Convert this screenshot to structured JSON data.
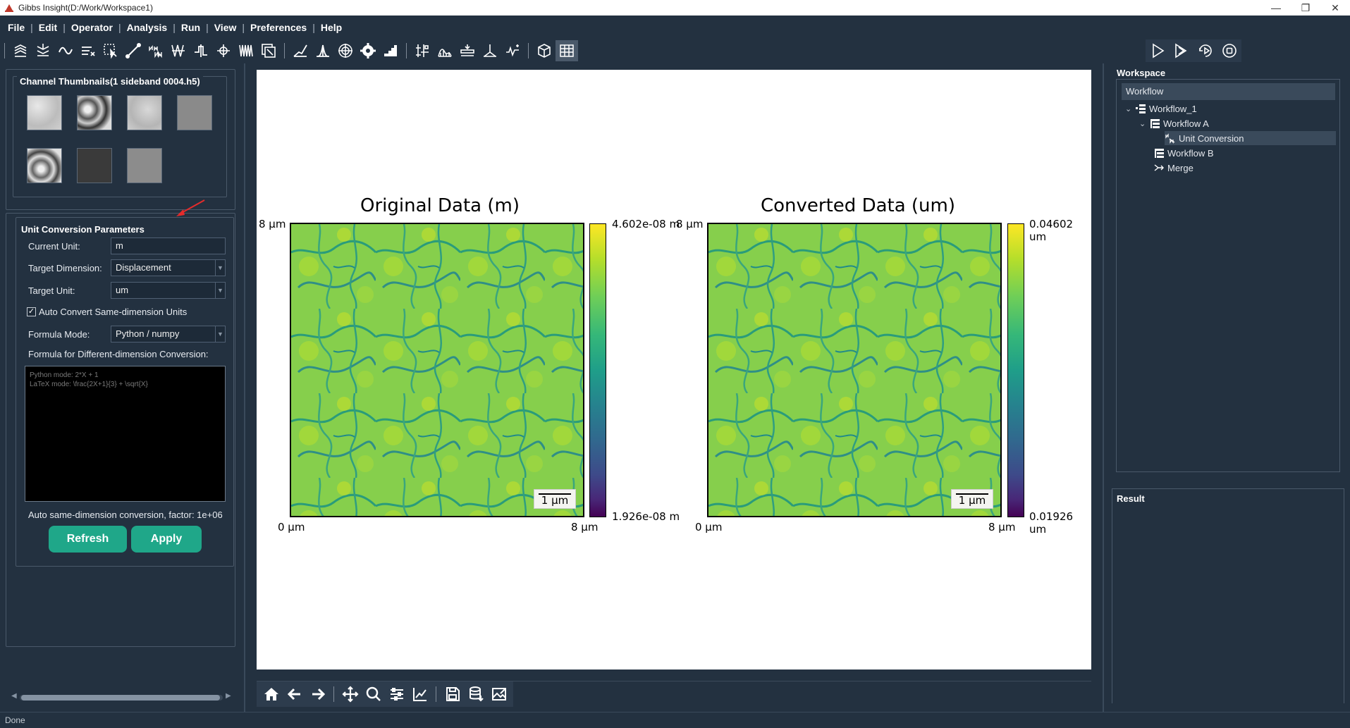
{
  "window": {
    "title": "Gibbs Insight(D:/Work/Workspace1)",
    "minimize": "—",
    "restore": "❐",
    "close": "✕"
  },
  "menu": [
    "File",
    "Edit",
    "Operator",
    "Analysis",
    "Run",
    "View",
    "Preferences",
    "Help"
  ],
  "menu_separator": "|",
  "left": {
    "thumbnails_title": "Channel Thumbnails(1 sideband 0004.h5)",
    "params_title": "Unit Conversion Parameters",
    "current_unit_label": "Current Unit:",
    "current_unit_value": "m",
    "target_dimension_label": "Target Dimension:",
    "target_dimension_value": "Displacement",
    "target_unit_label": "Target Unit:",
    "target_unit_value": "um",
    "auto_convert_label": "Auto Convert Same-dimension Units",
    "auto_convert_checked": true,
    "formula_mode_label": "Formula Mode:",
    "formula_mode_value": "Python / numpy",
    "formula_label": "Formula for Different-dimension Conversion:",
    "formula_placeholder": "Python mode: 2*X + 1\nLaTeX mode: \\frac{2X+1}{3} + \\sqrt{X}",
    "factor_text": "Auto same-dimension conversion, factor: 1e+06",
    "refresh_button": "Refresh",
    "apply_button": "Apply"
  },
  "plots": {
    "left": {
      "title": "Original Data (m)",
      "y_top": "8 µm",
      "x_left": "0 µm",
      "x_right": "8 µm",
      "cbar_max": "4.602e-08 m",
      "cbar_min": "1.926e-08 m",
      "scalebar": "1 µm"
    },
    "right": {
      "title": "Converted Data (um)",
      "y_top": "8 µm",
      "x_left": "0 µm",
      "x_right": "8 µm",
      "cbar_max": "0.04602 um",
      "cbar_min": "0.01926 um",
      "scalebar": "1 µm"
    }
  },
  "right": {
    "workspace_label": "Workspace",
    "workflow_header": "Workflow",
    "tree": [
      {
        "label": "Workflow_1",
        "level": 0,
        "expanded": true
      },
      {
        "label": "Workflow A",
        "level": 1,
        "expanded": true
      },
      {
        "label": "Unit Conversion",
        "level": 2,
        "selected": true
      },
      {
        "label": "Workflow B",
        "level": 1
      },
      {
        "label": "Merge",
        "level": 1
      }
    ],
    "result_label": "Result"
  },
  "status": "Done",
  "colors": {
    "background": "#233140",
    "accent_button": "#1fa789",
    "plot_area": "#ffffff"
  },
  "icons": {
    "toolbar": [
      "stack-icon",
      "import-icon",
      "smooth-icon",
      "filter-icon",
      "select-icon",
      "line-icon",
      "nm-icon",
      "fft-icon",
      "step-icon",
      "peak-icon",
      "wave-icon",
      "crop-icon",
      "curve-icon",
      "histogram-icon",
      "target-icon",
      "gear-icon",
      "stairs-icon",
      "grid-icon",
      "profile-icon",
      "layer-icon",
      "spectrum-icon",
      "flow-icon",
      "cube-icon",
      "table-icon"
    ],
    "run": [
      "run-icon",
      "run-step-icon",
      "rerun-icon",
      "stop-icon"
    ],
    "plot": [
      "home-icon",
      "back-icon",
      "forward-icon",
      "pan-icon",
      "zoom-icon",
      "configure-icon",
      "edit-axes-icon",
      "save-icon",
      "export-data-icon",
      "export-image-icon"
    ]
  }
}
